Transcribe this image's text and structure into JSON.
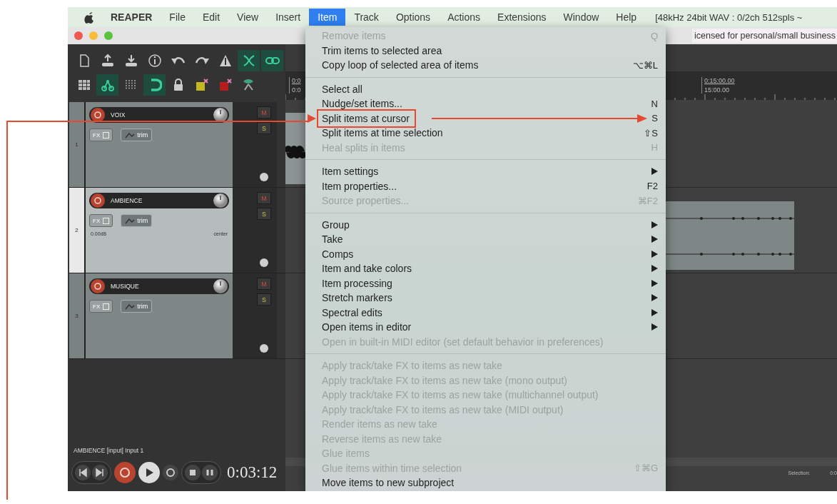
{
  "menubar": {
    "app_name": "REAPER",
    "menus": [
      {
        "label": "File",
        "selected": false
      },
      {
        "label": "Edit",
        "selected": false
      },
      {
        "label": "View",
        "selected": false
      },
      {
        "label": "Insert",
        "selected": false
      },
      {
        "label": "Item",
        "selected": true
      },
      {
        "label": "Track",
        "selected": false
      },
      {
        "label": "Options",
        "selected": false
      },
      {
        "label": "Actions",
        "selected": false
      },
      {
        "label": "Extensions",
        "selected": false
      },
      {
        "label": "Window",
        "selected": false
      },
      {
        "label": "Help",
        "selected": false
      }
    ],
    "status": "[48kHz 24bit WAV : 0/2ch 512spls ~"
  },
  "window": {
    "title": "icensed for personal/small business"
  },
  "toolbar": {
    "rows": [
      [
        {
          "on": false
        },
        {
          "on": false
        },
        {
          "on": false
        },
        {
          "on": false
        },
        {
          "on": false
        },
        {
          "on": false
        },
        {
          "on": false
        },
        {
          "on": true
        },
        {
          "on": true
        }
      ],
      [
        {
          "on": false
        },
        {
          "on": true
        },
        {
          "on": false
        },
        {
          "on": true
        },
        {
          "on": false
        },
        {
          "on": false
        },
        {
          "on": false
        },
        {
          "on": false
        }
      ]
    ]
  },
  "ruler": {
    "marks": [
      {
        "time": "0:0",
        "frames": "0:0"
      },
      {
        "time": "0:15:00.00",
        "frames": "15:00.00"
      }
    ]
  },
  "tracks": [
    {
      "number": "1",
      "name": "VOIX",
      "selected": false,
      "fx": "FX",
      "trim": "trim",
      "mute": "M",
      "solo": "S"
    },
    {
      "number": "2",
      "name": "AMBIENCE",
      "selected": true,
      "fx": "FX",
      "trim": "trim",
      "mute": "M",
      "solo": "S",
      "volume": "0.00dB",
      "pan": "center"
    },
    {
      "number": "3",
      "name": "MUSIQUE",
      "selected": false,
      "fx": "FX",
      "trim": "trim",
      "mute": "M",
      "solo": "S"
    }
  ],
  "status_line": "AMBIENCE [input] Input 1",
  "transport": {
    "time": "0:03:12"
  },
  "selection": {
    "label": "Selection:",
    "value": "0:0"
  },
  "menu": {
    "sections": [
      {
        "items": [
          {
            "label": "Remove items",
            "shortcut": "Q",
            "disabled": true,
            "submenu": false,
            "callout": false
          },
          {
            "label": "Trim items to selected area",
            "disabled": false,
            "submenu": false,
            "callout": false
          },
          {
            "label": "Copy loop of selected area of items",
            "shortcut": "⌥⌘L",
            "disabled": false,
            "submenu": false,
            "callout": false
          }
        ]
      },
      {
        "items": [
          {
            "label": "Select all",
            "disabled": false,
            "submenu": false,
            "callout": false
          },
          {
            "label": "Nudge/set items...",
            "shortcut": "N",
            "disabled": false,
            "submenu": false,
            "callout": false
          },
          {
            "label": "Split items at cursor",
            "shortcut": "S",
            "disabled": false,
            "submenu": false,
            "callout": true
          },
          {
            "label": "Split items at time selection",
            "shortcut": "⇧S",
            "disabled": false,
            "submenu": false,
            "callout": false
          },
          {
            "label": "Heal splits in items",
            "shortcut": "H",
            "disabled": true,
            "submenu": false,
            "callout": false
          }
        ]
      },
      {
        "items": [
          {
            "label": "Item settings",
            "disabled": false,
            "submenu": true,
            "callout": false
          },
          {
            "label": "Item properties...",
            "shortcut": "F2",
            "disabled": false,
            "submenu": false,
            "callout": false
          },
          {
            "label": "Source properties...",
            "shortcut": "⌘F2",
            "disabled": true,
            "submenu": false,
            "callout": false
          }
        ]
      },
      {
        "items": [
          {
            "label": "Group",
            "disabled": false,
            "submenu": true,
            "callout": false
          },
          {
            "label": "Take",
            "disabled": false,
            "submenu": true,
            "callout": false
          },
          {
            "label": "Comps",
            "disabled": false,
            "submenu": true,
            "callout": false
          },
          {
            "label": "Item and take colors",
            "disabled": false,
            "submenu": true,
            "callout": false
          },
          {
            "label": "Item processing",
            "disabled": false,
            "submenu": true,
            "callout": false
          },
          {
            "label": "Stretch markers",
            "disabled": false,
            "submenu": true,
            "callout": false
          },
          {
            "label": "Spectral edits",
            "disabled": false,
            "submenu": true,
            "callout": false
          },
          {
            "label": "Open items in editor",
            "disabled": false,
            "submenu": true,
            "callout": false
          },
          {
            "label": "Open in built-in MIDI editor (set default behavior in preferences)",
            "disabled": true,
            "submenu": false,
            "callout": false
          }
        ]
      },
      {
        "items": [
          {
            "label": "Apply track/take FX to items as new take",
            "disabled": true,
            "submenu": false,
            "callout": false
          },
          {
            "label": "Apply track/take FX to items as new take (mono output)",
            "disabled": true,
            "submenu": false,
            "callout": false
          },
          {
            "label": "Apply track/take FX to items as new take (multichannel output)",
            "disabled": true,
            "submenu": false,
            "callout": false
          },
          {
            "label": "Apply track/take FX to items as new take (MIDI output)",
            "disabled": true,
            "submenu": false,
            "callout": false
          },
          {
            "label": "Render items as new take",
            "disabled": true,
            "submenu": false,
            "callout": false
          },
          {
            "label": "Reverse items as new take",
            "disabled": true,
            "submenu": false,
            "callout": false
          },
          {
            "label": "Glue items",
            "disabled": true,
            "submenu": false,
            "callout": false
          },
          {
            "label": "Glue items within time selection",
            "shortcut": "⇧⌘G",
            "disabled": true,
            "submenu": false,
            "callout": false
          },
          {
            "label": "Move items to new subproject",
            "disabled": false,
            "submenu": false,
            "callout": false
          }
        ]
      }
    ]
  }
}
